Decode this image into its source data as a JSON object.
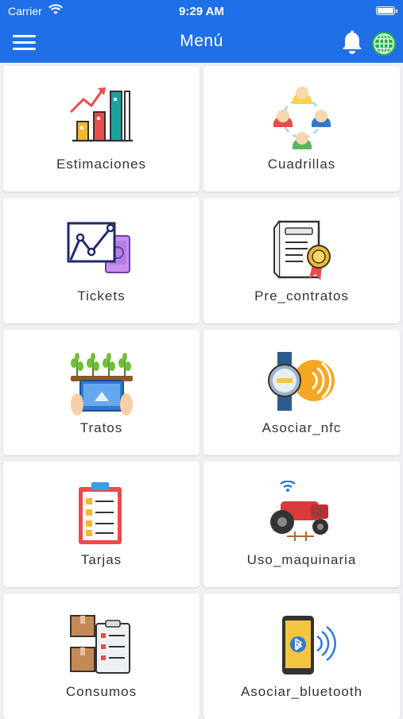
{
  "status_bar": {
    "carrier": "Carrier",
    "time": "9:29 AM"
  },
  "header": {
    "title": "Menú"
  },
  "menu_items": [
    {
      "label": "Estimaciones",
      "icon": "bar-chart-growth-icon"
    },
    {
      "label": "Cuadrillas",
      "icon": "team-group-icon"
    },
    {
      "label": "Tickets",
      "icon": "tablet-graph-icon"
    },
    {
      "label": "Pre_contratos",
      "icon": "certificate-contract-icon"
    },
    {
      "label": "Tratos",
      "icon": "plants-tablet-icon"
    },
    {
      "label": "Asociar_nfc",
      "icon": "nfc-watch-icon"
    },
    {
      "label": "Tarjas",
      "icon": "clipboard-checklist-icon"
    },
    {
      "label": "Uso_maquinaria",
      "icon": "tractor-icon"
    },
    {
      "label": "Consumos",
      "icon": "boxes-checklist-icon"
    },
    {
      "label": "Asociar_bluetooth",
      "icon": "phone-bluetooth-icon"
    }
  ],
  "colors": {
    "header": "#1f6fe6",
    "background": "#eef0f3",
    "card": "#ffffff"
  }
}
